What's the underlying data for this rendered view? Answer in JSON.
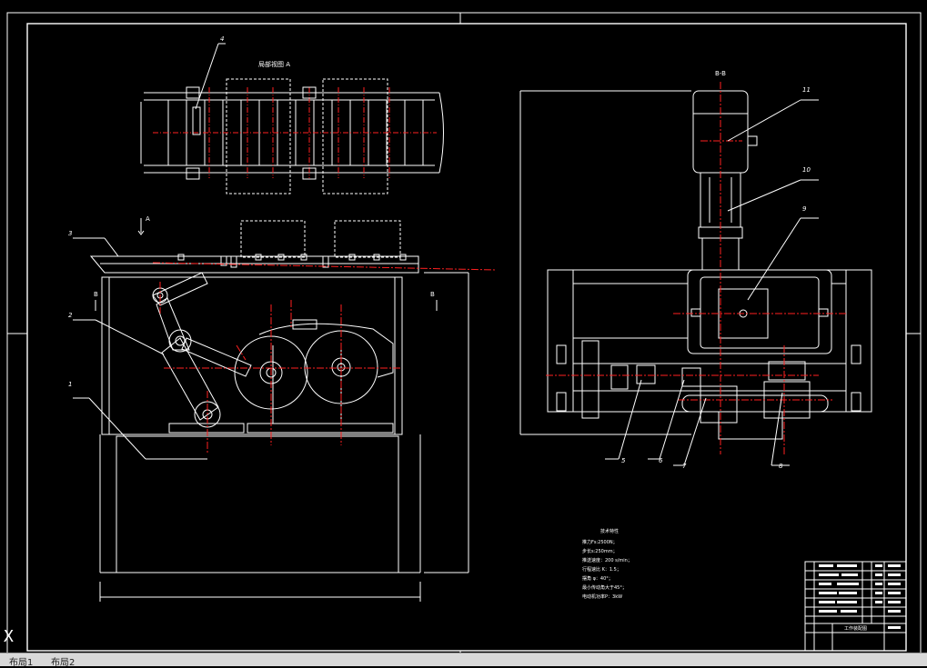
{
  "drawing": {
    "partial_view_label": "局部视图 A",
    "section_label": "B-B",
    "view_arrow_a": "A",
    "section_mark_left": "B",
    "section_mark_right": "B",
    "callouts_left": [
      "4",
      "3",
      "2",
      "1"
    ],
    "callouts_right": [
      "11",
      "10",
      "9",
      "5",
      "6",
      "7",
      "8"
    ],
    "tech_title": "技术特性",
    "tech_notes": [
      "推力Fs:2500N；",
      "步长s:250mm；",
      "推送速度：200 s/min；",
      "行程速比 K：1.5；",
      "摆角 φ：40°；",
      "最小传动角大于45°；",
      "电动机功率P：3kW"
    ],
    "title_block_name": "工作装配图"
  },
  "tabs": {
    "layout1": "布局1",
    "layout2": "布局2"
  },
  "colors": {
    "background": "#000000",
    "lines": "#ffffff",
    "center_lines": "#ff2020",
    "tab_bar": "#d8d8d8"
  }
}
